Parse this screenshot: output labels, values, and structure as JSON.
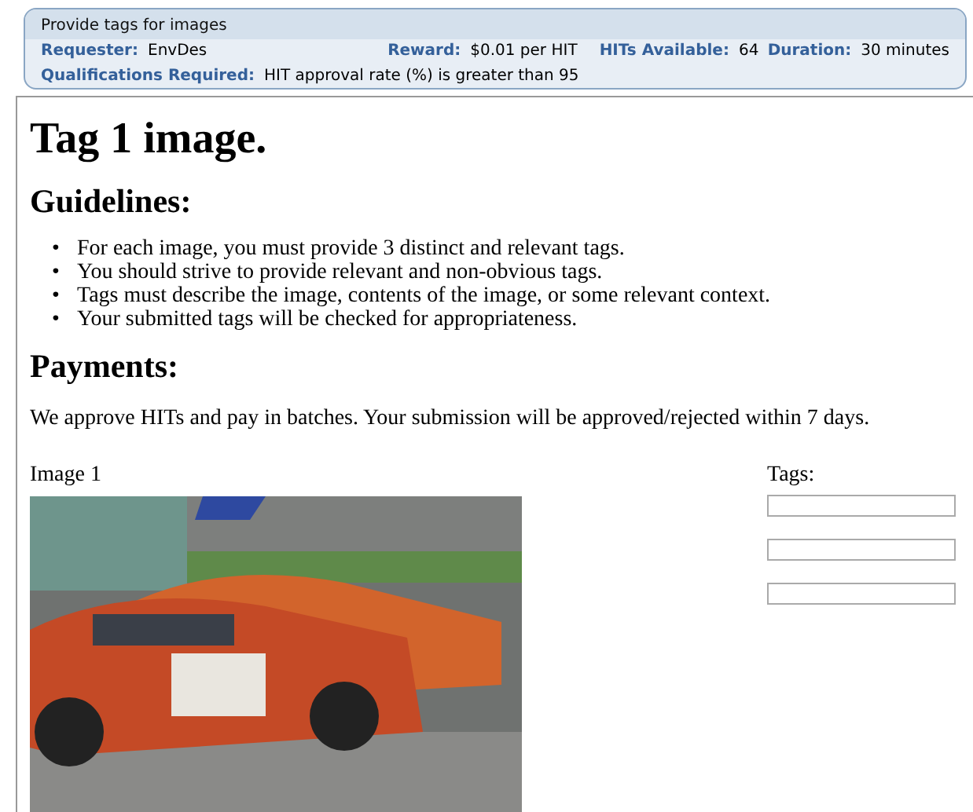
{
  "hit_header": {
    "title": "Provide tags for images",
    "fields": [
      {
        "label": "Requester:",
        "value": "EnvDes"
      },
      {
        "label": "Reward:",
        "value": "$0.01 per HIT"
      },
      {
        "label": "HITs Available:",
        "value": "64"
      },
      {
        "label": "Duration:",
        "value": "30 minutes"
      }
    ],
    "qualifications": {
      "label": "Qualifications Required:",
      "value": "HIT approval rate (%) is greater than 95"
    }
  },
  "heading": "Tag 1 image.",
  "guidelines": {
    "heading": "Guidelines:",
    "items": [
      {
        "marker": "•",
        "text": "For each image, you must provide 3 distinct and relevant tags."
      },
      {
        "marker": "•",
        "text": "You should strive to provide relevant and non-obvious tags."
      },
      {
        "marker": "•",
        "text": "Tags must describe the image, contents of the image, or some relevant context."
      },
      {
        "marker": "•",
        "text": "Your submitted tags will be checked for appropriateness."
      }
    ]
  },
  "payments": {
    "heading": "Payments:",
    "text": "We approve HITs and pay in batches. Your submission will be approved/rejected within 7 days."
  },
  "image": {
    "caption": "Image 1",
    "kind": "picture"
  },
  "tags": {
    "label": "Tags:",
    "fields": [
      {
        "kind": "text"
      },
      {
        "kind": "text"
      },
      {
        "kind": "text"
      }
    ]
  }
}
